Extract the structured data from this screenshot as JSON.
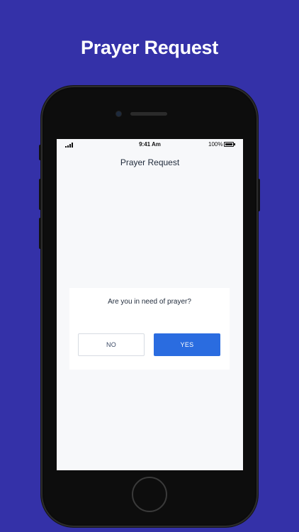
{
  "page": {
    "heading": "Prayer Request",
    "background_color": "#3431a8"
  },
  "status_bar": {
    "time": "9:41 Am",
    "battery": "100%",
    "signal_icon": "signal-bars-icon",
    "battery_icon": "battery-full-icon"
  },
  "screen": {
    "title": "Prayer Request"
  },
  "dialog": {
    "question": "Are you in need of prayer?",
    "no_label": "NO",
    "yes_label": "YES",
    "yes_color": "#2a6ce0"
  }
}
